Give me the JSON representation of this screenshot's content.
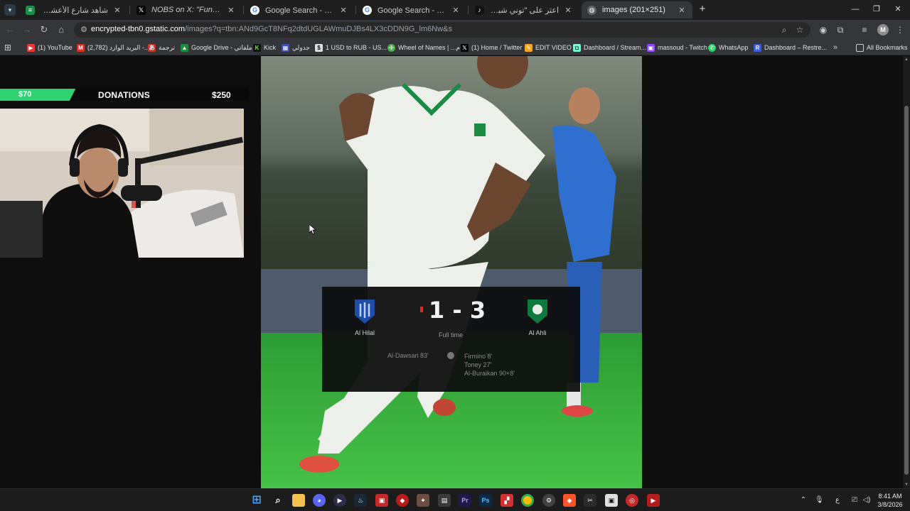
{
  "tabs": [
    {
      "title": "شاهد شارع الأعشى - الموسم 2 /",
      "favicon": "green-doc-icon",
      "active": false
    },
    {
      "title": "NOBS on X: \"Funny how life w",
      "favicon": "x-icon",
      "active": false
    },
    {
      "title": "Google Search - حلاقة رونالدو",
      "favicon": "google-icon",
      "active": false
    },
    {
      "title": "Google Search - هل هبط الشباب",
      "favicon": "google-icon",
      "active": false
    },
    {
      "title": "اعثر على \"توني شبة نار\" على TikTok",
      "favicon": "tiktok-icon",
      "active": false
    },
    {
      "title": "images (201×251)",
      "favicon": "globe-icon",
      "active": true
    }
  ],
  "address": {
    "host": "encrypted-tbn0.gstatic.com",
    "path": "/images?q=tbn:ANd9GcT8NFq2dtdUGLAWmuDJBs4LX3cDDN9G_lm6Nw&s"
  },
  "bookmarks": [
    {
      "label": "(1) YouTube",
      "icon": "youtube-icon",
      "color": "#e53935"
    },
    {
      "label": "(2,782) البريد الوارد -...",
      "icon": "gmail-icon",
      "color": "#d93025"
    },
    {
      "label": "ترجمة",
      "icon": "translate-icon",
      "color": "#c0392b"
    },
    {
      "label": "Google Drive - ملفاتي",
      "icon": "drive-icon",
      "color": "#1e8e3e"
    },
    {
      "label": "Kick",
      "icon": "kick-icon",
      "color": "#53fc18"
    },
    {
      "label": "جدولي",
      "icon": "calendar-icon",
      "color": "#3f51b5"
    },
    {
      "label": "1 USD to RUB - US...",
      "icon": "currency-icon",
      "color": "#e0e0e0"
    },
    {
      "label": "Wheel of Names | ...م",
      "icon": "wheel-icon",
      "color": "#4caf50"
    },
    {
      "label": "(1) Home / Twitter",
      "icon": "x-icon",
      "color": "#000000"
    },
    {
      "label": "EDIT VIDEO",
      "icon": "edit-video-icon",
      "color": "#f5a623"
    },
    {
      "label": "Dashboard / Stream...",
      "icon": "streamlabs-icon",
      "color": "#80f5d2"
    },
    {
      "label": "massoud - Twitch",
      "icon": "twitch-icon",
      "color": "#9146ff"
    },
    {
      "label": "WhatsApp",
      "icon": "whatsapp-icon",
      "color": "#25d366"
    },
    {
      "label": "Dashboard – Restre...",
      "icon": "restream-icon",
      "color": "#3b5bdb"
    }
  ],
  "all_bookmarks": "All Bookmarks",
  "avatar_letter": "M",
  "donation": {
    "current": "$70",
    "title": "DONATIONS",
    "goal": "$250",
    "progress": 0.28
  },
  "scorecard": {
    "home": "Al Hilal",
    "away": "Al Ahli",
    "score": "1 - 3",
    "status": "Full time",
    "home_scorers": "Al-Dawsari 83'",
    "away_scorers": [
      "Firmino 8'",
      "Toney 27'",
      "Al-Buraikan 90+8'"
    ]
  },
  "taskbar": {
    "time": "8:41 AM",
    "date": "3/8/2026",
    "lang": "ع"
  },
  "colors": {
    "accent_green": "#2fd170",
    "hilal_blue": "#1f4ea8",
    "ahli_green": "#0f7a3f"
  }
}
